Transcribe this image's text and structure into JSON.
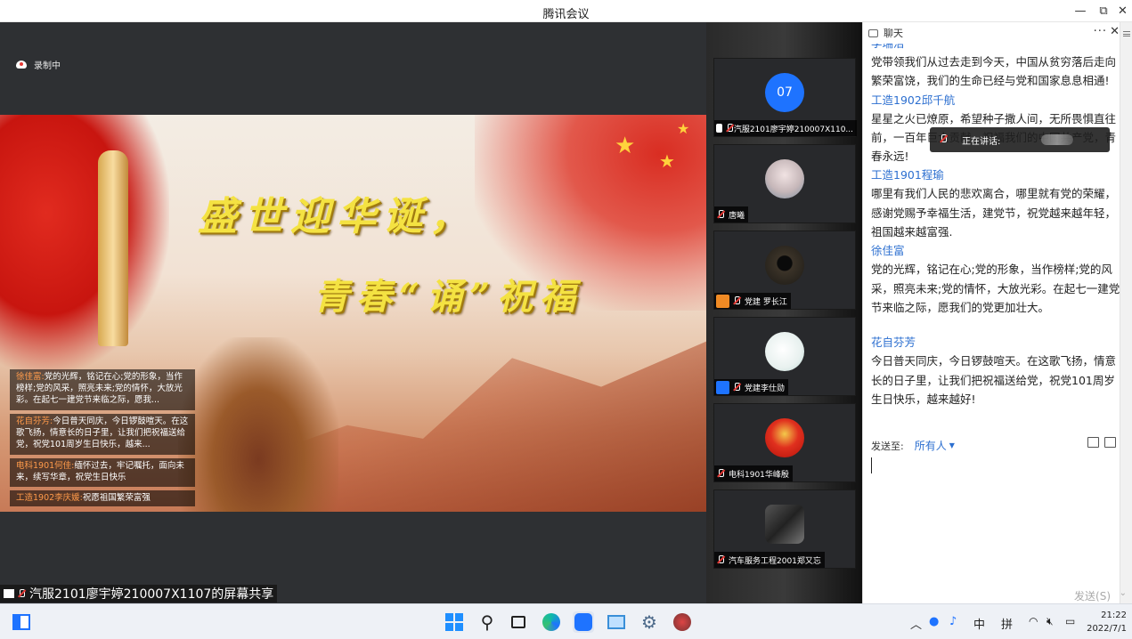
{
  "window": {
    "title": "腾讯会议"
  },
  "recording": {
    "label": "录制中"
  },
  "share_content": {
    "headline1": "盛世迎华诞，",
    "headline2": "青春“诵”祝福"
  },
  "danmu": [
    {
      "name": "徐佳富:",
      "text": "党的光辉，铭记在心;党的形象，当作榜样;党的风采，照亮未来;党的情怀，大放光彩。在起七一建党节来临之际，愿我..."
    },
    {
      "name": "花自芬芳:",
      "text": "今日普天同庆，今日锣鼓喧天。在这歌飞扬，情意长的日子里，让我们把祝福送给党，祝党101周岁生日快乐，越来..."
    },
    {
      "name": "电科1901何佳:",
      "text": "缅怀过去，牢记嘱托，面向未来，续写华章，祝党生日快乐"
    },
    {
      "name": "工造1902李庆媛:",
      "text": "祝愿祖国繁荣富强"
    }
  ],
  "share_caption": "汽服2101廖宇婷210007X1107的屏幕共享",
  "participants": [
    {
      "avatar_text": "07",
      "avatar_color": "#1e73ff",
      "name": "汽服2101廖宇婷210007X110..."
    },
    {
      "avatar_text": "",
      "avatar_color": "#8fa3b3",
      "name": "唐曦"
    },
    {
      "avatar_text": "",
      "avatar_color": "#3b3328",
      "name": "党建 罗长江"
    },
    {
      "avatar_text": "",
      "avatar_color": "#e8f1ef",
      "name": "党建李仕勋"
    },
    {
      "avatar_text": "",
      "avatar_color": "#d7201a",
      "name": "电科1901华峰殷"
    },
    {
      "avatar_text": "",
      "avatar_color": "#2c2c2c",
      "name": "汽车服务工程2001郑又忘"
    }
  ],
  "chat": {
    "title": "聊天",
    "more_label": "···",
    "close_label": "✕",
    "messages": [
      {
        "who": "李瑞洁",
        "text": "党带领我们从过去走到今天，中国从贫穷落后走向繁荣富饶，我们的生命已经与党和国家息息相通!"
      },
      {
        "who": "工造1902邱千航",
        "text": "星星之火已燎原，希望种子撒人间，无所畏惧直往前，一百年巨大贡献，祝福我们的中国共产党，青春永远!"
      },
      {
        "who": "工造1901程瑜",
        "text": "哪里有我们人民的悲欢离合，哪里就有党的荣耀，感谢党赐予幸福生活，建党节，祝党越来越年轻，祖国越来越富强."
      },
      {
        "who": "徐佳富",
        "text": "党的光辉，铭记在心;党的形象，当作榜样;党的风采，照亮未来;党的情怀，大放光彩。在起七一建党节来临之际，愿我们的党更加壮大。"
      },
      {
        "who": "花自芬芳",
        "text": "今日普天同庆，今日锣鼓喧天。在这歌飞扬，情意长的日子里，让我们把祝福送给党，祝党101周岁生日快乐，越来越好!"
      }
    ],
    "speaking_label": "正在讲话:",
    "send_to_label": "发送至:",
    "send_to_value": "所有人",
    "send_button": "发送(S)"
  },
  "taskbar": {
    "tray_lang": "中",
    "tray_ime": "拼",
    "time": "21:22",
    "date": "2022/7/1"
  }
}
